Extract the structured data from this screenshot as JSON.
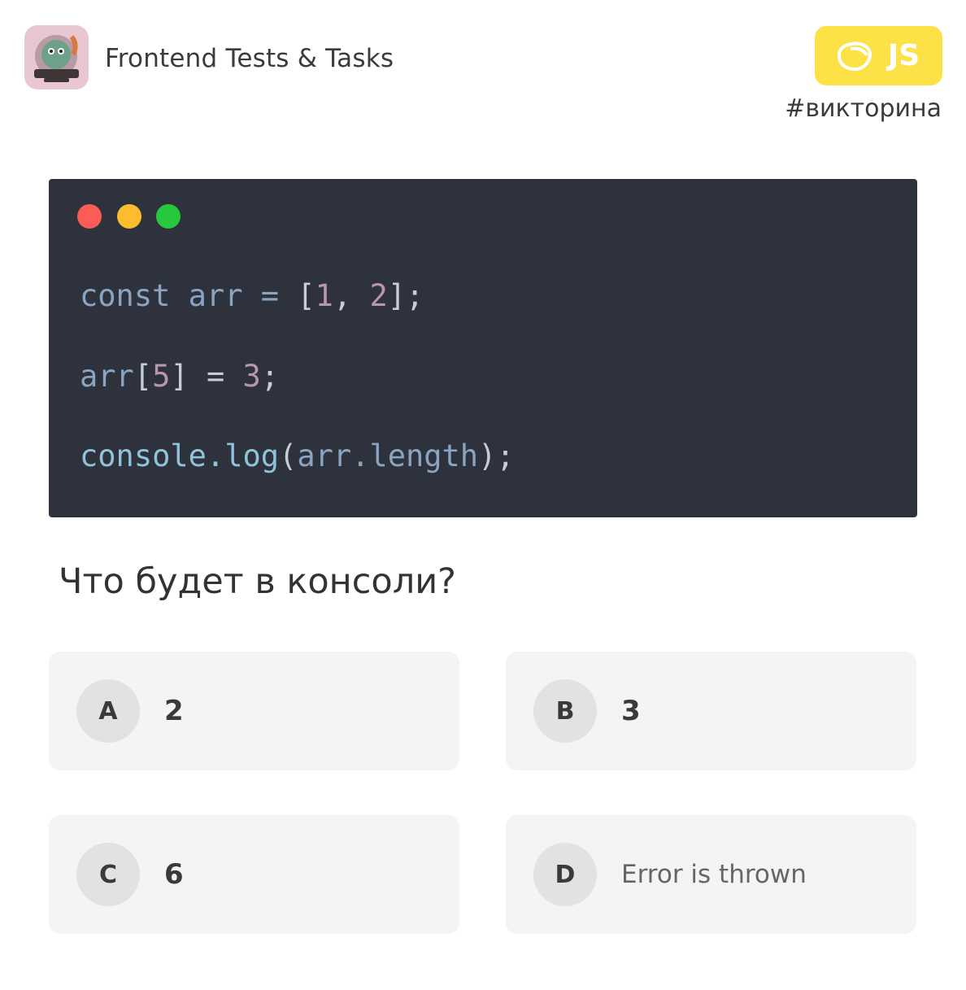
{
  "header": {
    "logo_icon": "frontend-logo-icon",
    "channel_name": "Frontend Tests & Tasks",
    "badge_icon": "js-badge-icon",
    "badge_label": "JS",
    "hashtag": "#викторина"
  },
  "code": {
    "lines": [
      {
        "parts": [
          "const arr = ",
          "[",
          "1",
          ", ",
          "2",
          "];"
        ]
      },
      {
        "parts": [
          "arr",
          "[",
          "5",
          "]",
          " = ",
          "3",
          ";"
        ]
      },
      {
        "parts": [
          "console.log",
          "(",
          "arr.length",
          ");"
        ]
      }
    ]
  },
  "question": "Что будет в консоли?",
  "options": [
    {
      "letter": "A",
      "text": "2"
    },
    {
      "letter": "B",
      "text": "3"
    },
    {
      "letter": "C",
      "text": "6"
    },
    {
      "letter": "D",
      "text": "Error is thrown"
    }
  ],
  "colors": {
    "badge": "#fde247",
    "code_bg": "#2e323d",
    "dot_red": "#fb5c55",
    "dot_yellow": "#fdbb2e",
    "dot_green": "#27c73e"
  }
}
